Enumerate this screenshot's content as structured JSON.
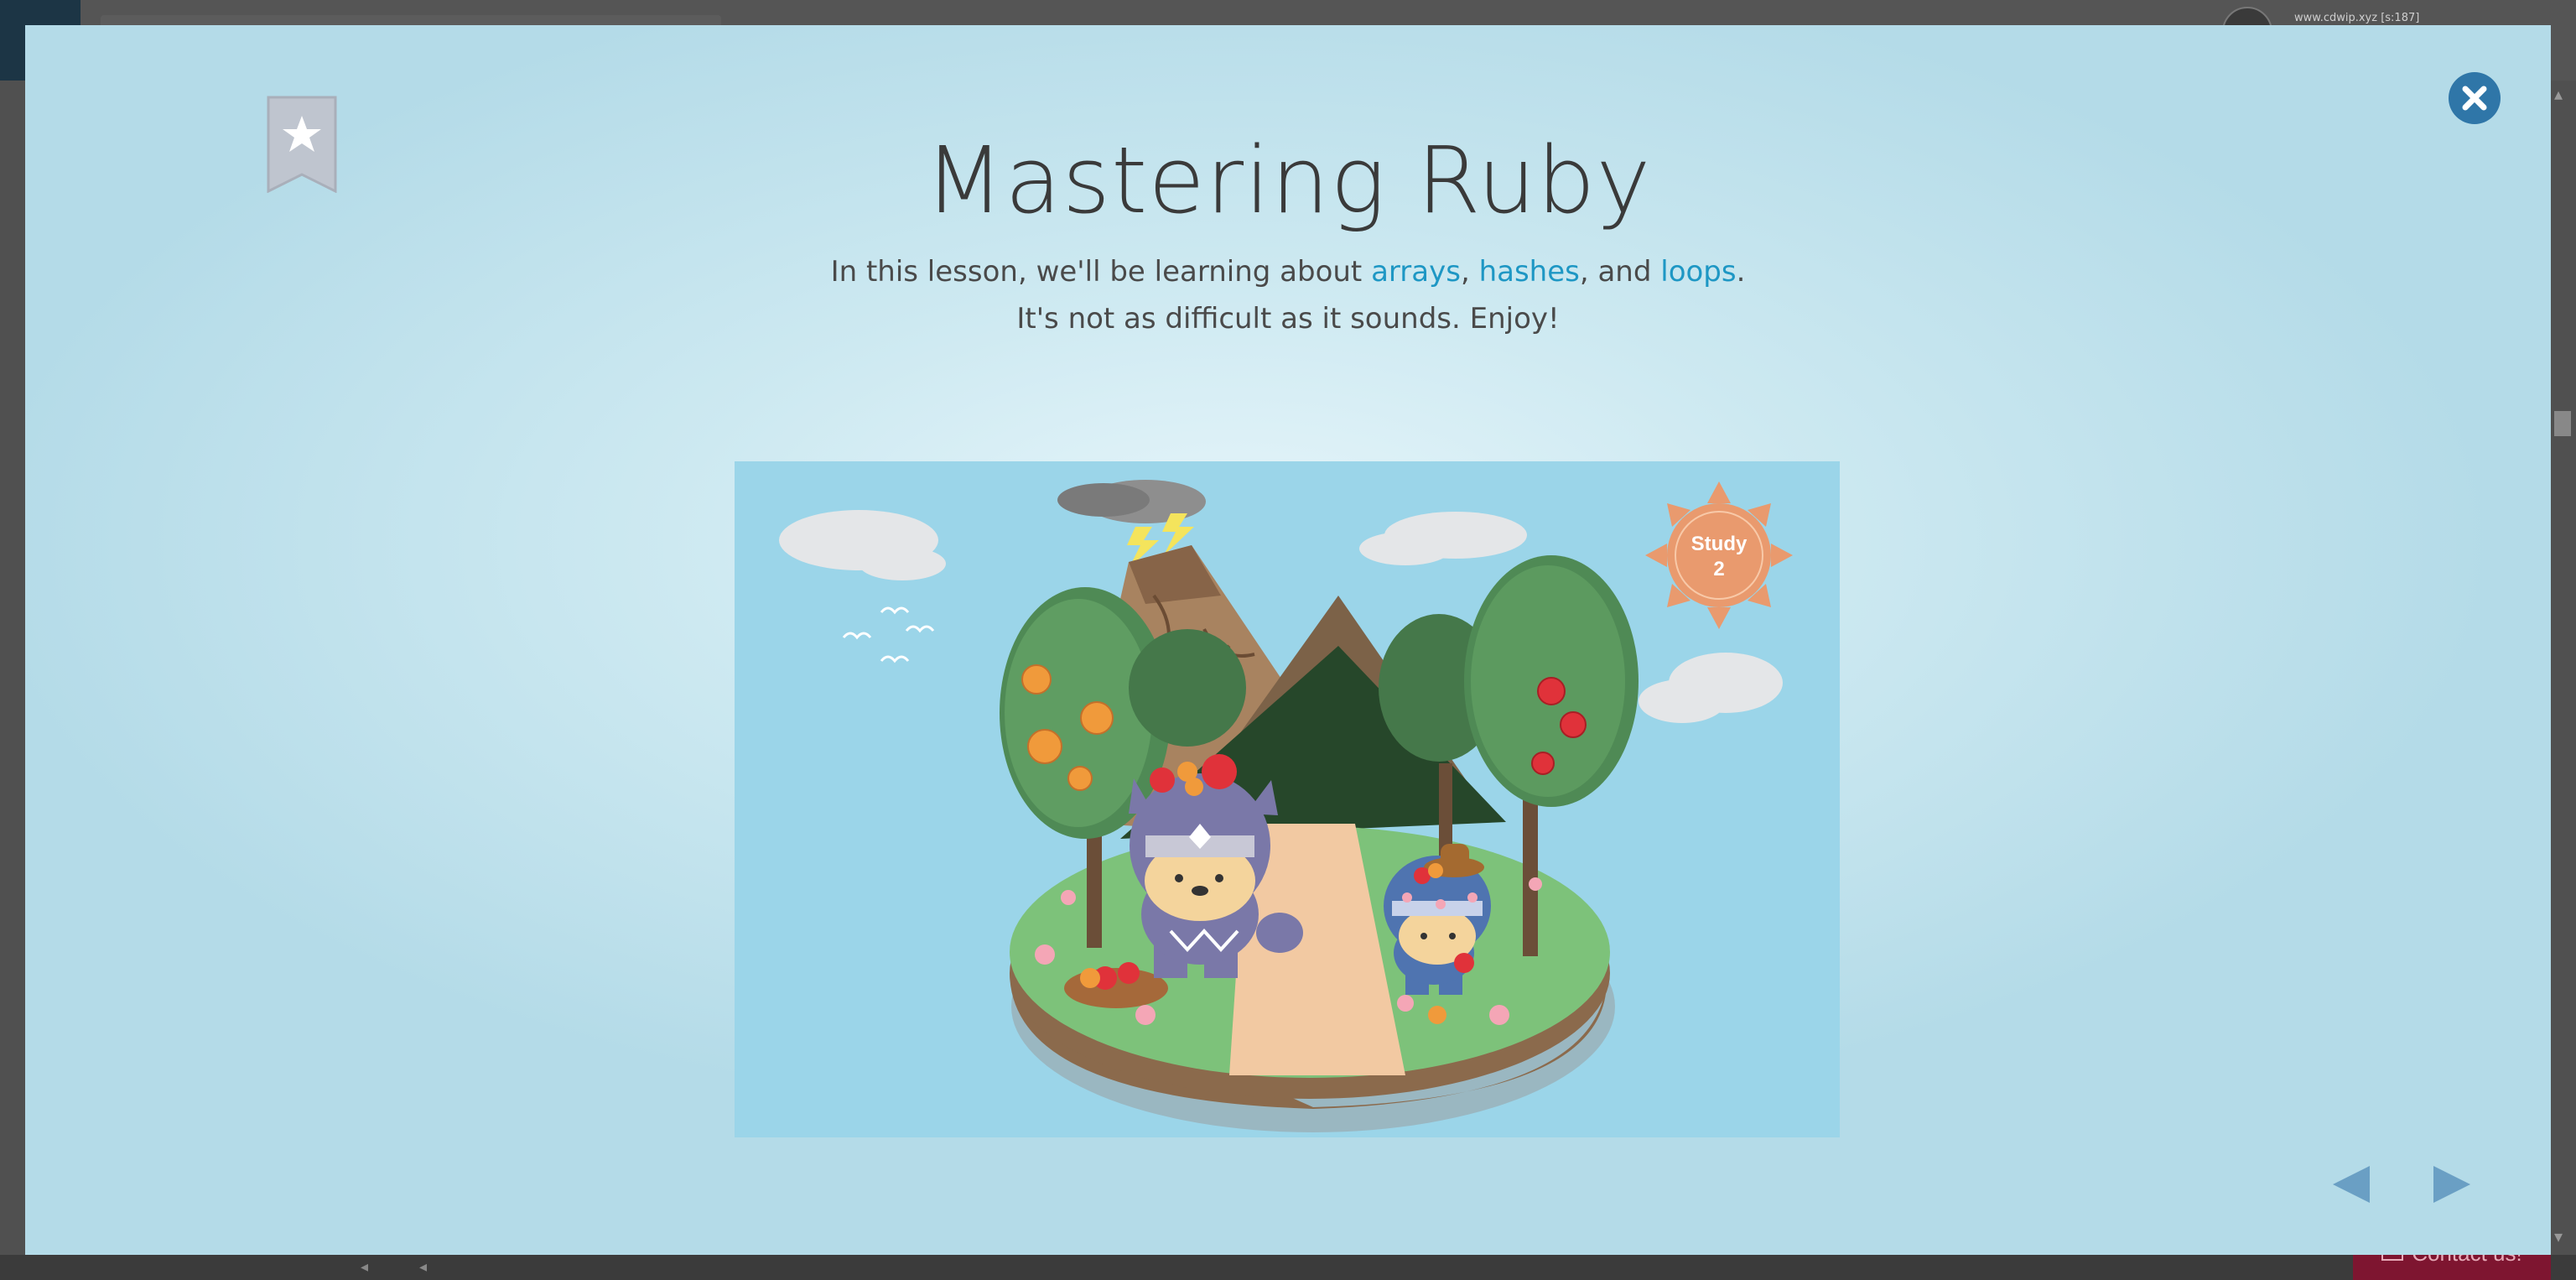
{
  "background": {
    "user_label": "www.cdwip.xyz [s:187]",
    "contact_label": "Contact us!"
  },
  "modal": {
    "title": "Mastering Ruby",
    "description": {
      "intro": "In this lesson, we'll be learning about ",
      "topics": [
        "arrays",
        "hashes",
        "loops"
      ],
      "sep1": ", ",
      "sep2": ", and ",
      "end": ".",
      "line2": "It's not as difficult as it sounds. Enjoy!"
    },
    "illustration": {
      "sun_label_line1": "Study",
      "sun_label_line2": "2"
    }
  },
  "icons": {
    "bookmark": "bookmark-star-icon",
    "close": "close-icon",
    "prev": "triangle-left-icon",
    "next": "triangle-right-icon"
  },
  "colors": {
    "accent_link": "#1e97c4",
    "close_button": "#2f76a8",
    "nav_arrow": "#6a9fc4",
    "title_text": "#3a3a3a"
  }
}
